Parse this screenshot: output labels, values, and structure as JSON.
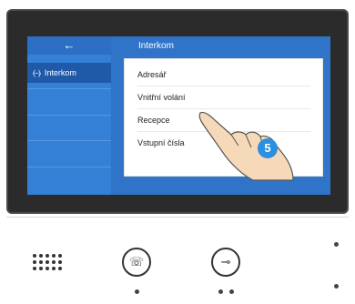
{
  "screen": {
    "sidebar": {
      "back_icon": "arrow-left-icon",
      "back_glyph": "←",
      "items": [
        {
          "label": "Interkom",
          "icon": "intercom-icon",
          "icon_glyph": "⦑-⦒"
        }
      ]
    },
    "header": {
      "title": "Interkom"
    },
    "menu": [
      {
        "label": "Adresář"
      },
      {
        "label": "Vnitřní volání"
      },
      {
        "label": "Recepce"
      },
      {
        "label": "Vstupní čísla"
      }
    ],
    "step_badge": "5"
  },
  "panel": {
    "buttons": [
      {
        "name": "talk-button",
        "icon": "handset-icon",
        "glyph": "☏"
      },
      {
        "name": "unlock-button",
        "icon": "key-icon",
        "glyph": "⊸"
      }
    ]
  },
  "colors": {
    "screen_bg": "#2f74c8",
    "sidebar_active": "#1f5aa8",
    "badge": "#2c8fe0"
  }
}
